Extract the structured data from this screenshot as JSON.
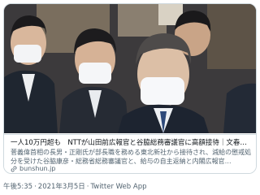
{
  "card": {
    "headline": "一人10万円超も　NTTが山田前広報官と谷脇総務審議官に高額接待｜文春オン…",
    "description": "菅義偉首相の長男・正剛氏が部長職を務める東北新社から接待され、減給の懲戒処分を受けた谷脇康彦・総務省総務審議官と、給与の自主返納と内閣広報官…",
    "source": "bunshun.jp",
    "link_icon": "link-icon"
  },
  "footer": {
    "time": "午後5:35",
    "separator": "·",
    "date": "2021年3月5日",
    "client": "Twitter Web App"
  }
}
